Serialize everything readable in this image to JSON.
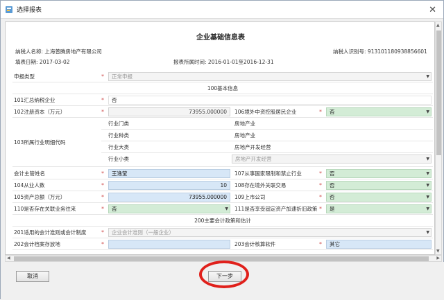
{
  "window": {
    "title": "选择报表",
    "close_glyph": "✕"
  },
  "form": {
    "title": "企业基础信息表",
    "taxpayer_name_label": "纳税人名称:",
    "taxpayer_name": "上海普腾房地产有限公司",
    "taxpayer_id_label": "纳税人识别号:",
    "taxpayer_id": "913101180938856601",
    "fill_date_label": "填表日期:",
    "fill_date": "2017-03-02",
    "period_label": "报表所属时间:",
    "period": "2016-01-01至2016-12-31"
  },
  "declaration_type": {
    "label": "申报类型",
    "value": "正常申报"
  },
  "section_100": "100基本信息",
  "r101": {
    "label": "101汇总纳税企业",
    "value": "否"
  },
  "r102": {
    "label": "102注册资本（万元）",
    "value": "73955.000000"
  },
  "r106": {
    "label": "106境外中资控股居民企业",
    "value": "否"
  },
  "r103": {
    "label": "103所属行业明细代码",
    "rows": [
      {
        "name": "行业门类",
        "value": "房地产业"
      },
      {
        "name": "行业种类",
        "value": "房地产业"
      },
      {
        "name": "行业大类",
        "value": "房地产开发经营"
      },
      {
        "name": "行业小类",
        "value": "房地产开发经营"
      }
    ]
  },
  "r_accounting": {
    "label": "会计主管姓名",
    "value": "王逸莹"
  },
  "r107": {
    "label": "107从事国家限制和禁止行业",
    "value": "否"
  },
  "r104": {
    "label": "104从业人数",
    "value": "10"
  },
  "r108": {
    "label": "108存在境外关联交易",
    "value": "否"
  },
  "r105": {
    "label": "105资产总额（万元）",
    "value": "73955.000000"
  },
  "r109": {
    "label": "109上市公司",
    "value": "否"
  },
  "r110": {
    "label": "110是否存在关联业务往来",
    "value": "否"
  },
  "r111": {
    "label": "111是否享受固定资产加速折旧政策",
    "value": "是"
  },
  "section_200": "200主要会计政策和估计",
  "r201": {
    "label": "201适用的会计准则或会计制度",
    "value": "企业会计准则（一般企业）"
  },
  "r202": {
    "label": "202会计档案存放地",
    "value": ""
  },
  "r203": {
    "label": "203会计核算软件",
    "value": "其它"
  },
  "required_mark": "*",
  "buttons": {
    "cancel": "取消",
    "next": "下一步"
  },
  "colors": {
    "annotation_circle": "#e0201b",
    "input_blue": "#d7e7f7",
    "input_green": "#d3ecd6"
  }
}
